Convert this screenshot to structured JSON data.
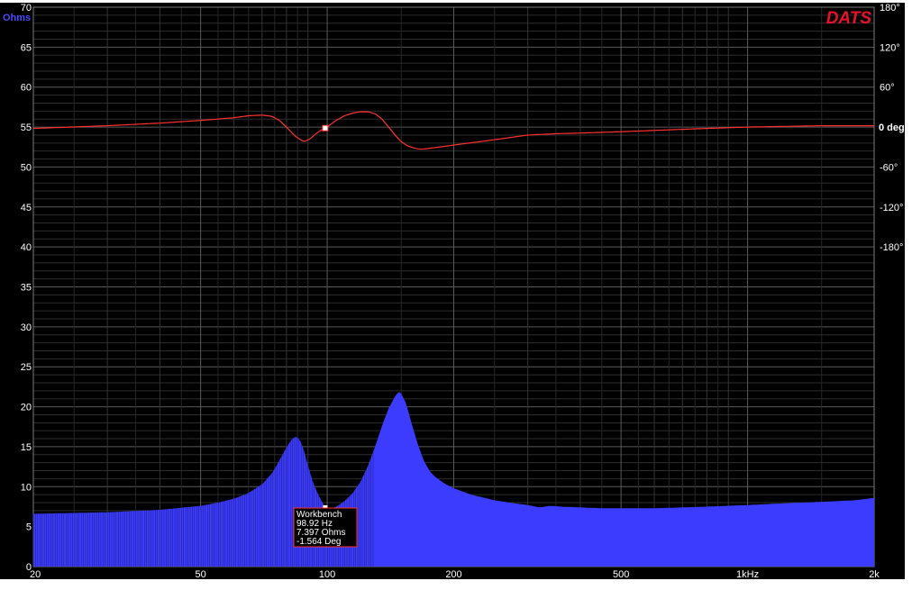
{
  "chart_data": {
    "type": "area",
    "brand": "DATS",
    "x_axis": {
      "scale": "log",
      "range_hz": [
        20,
        2000
      ],
      "tick_values": [
        20,
        50,
        100,
        200,
        500,
        1000,
        2000
      ],
      "tick_labels": [
        "20",
        "50",
        "100",
        "200",
        "500",
        "1kHz",
        "2k"
      ]
    },
    "y_left": {
      "label": "Ohms",
      "range": [
        0,
        70
      ],
      "ticks": [
        0,
        5,
        10,
        15,
        20,
        25,
        30,
        35,
        40,
        45,
        50,
        55,
        60,
        65,
        70
      ],
      "color": "#4a4aff"
    },
    "y_right": {
      "range_deg": [
        -180,
        180
      ],
      "ticks": [
        180,
        120,
        60,
        0,
        -60,
        -120,
        -180
      ],
      "tick_labels": [
        "180°",
        "120°",
        "60°",
        "0 deg",
        "-60°",
        "-120°",
        "-180°"
      ],
      "zero_color": "#e03030"
    },
    "grid": true,
    "series": [
      {
        "kind": "impedance",
        "color": "#3c3cff",
        "x": [
          20,
          30,
          40,
          50,
          55,
          60,
          65,
          70,
          74,
          77,
          80,
          82,
          84,
          86,
          88,
          90,
          93,
          96,
          99,
          102,
          106,
          110,
          115,
          120,
          125,
          130,
          135,
          140,
          145,
          148,
          150,
          153,
          156,
          160,
          165,
          170,
          175,
          180,
          190,
          200,
          220,
          250,
          280,
          300,
          320,
          340,
          360,
          400,
          450,
          500,
          600,
          700,
          800,
          1000,
          1200,
          1500,
          1800,
          2000
        ],
        "y": [
          6.6,
          6.8,
          7.1,
          7.6,
          8.0,
          8.5,
          9.2,
          10.3,
          11.7,
          13.3,
          14.9,
          15.8,
          16.3,
          15.9,
          14.6,
          12.6,
          10.2,
          8.6,
          7.4,
          7.2,
          7.6,
          8.2,
          9.2,
          10.6,
          12.6,
          15.0,
          17.6,
          19.8,
          21.3,
          21.9,
          21.6,
          20.8,
          19.4,
          17.3,
          15.0,
          13.2,
          12.0,
          11.3,
          10.4,
          9.8,
          9.0,
          8.3,
          7.9,
          7.7,
          7.4,
          7.6,
          7.5,
          7.4,
          7.3,
          7.3,
          7.3,
          7.4,
          7.5,
          7.7,
          7.9,
          8.1,
          8.3,
          8.6
        ]
      },
      {
        "kind": "phase",
        "color": "#ff3030",
        "x": [
          20,
          30,
          40,
          50,
          60,
          65,
          70,
          74,
          77,
          80,
          84,
          88,
          91,
          94,
          97,
          100,
          105,
          110,
          115,
          120,
          125,
          130,
          135,
          140,
          145,
          150,
          155,
          160,
          165,
          170,
          175,
          180,
          190,
          200,
          250,
          300,
          350,
          400,
          500,
          600,
          800,
          1000,
          1500,
          2000
        ],
        "y": [
          -2,
          2,
          6,
          10,
          14,
          17,
          18,
          16,
          10,
          0,
          -14,
          -22,
          -18,
          -10,
          -4,
          0,
          10,
          17,
          21,
          23,
          23,
          20,
          12,
          0,
          -12,
          -22,
          -28,
          -31,
          -33,
          -33,
          -32,
          -31,
          -29,
          -27,
          -19,
          -12,
          -10,
          -9,
          -7,
          -5,
          -2,
          0,
          2,
          2
        ]
      }
    ],
    "annotation": {
      "lines": [
        "Workbench",
        "98.92 Hz",
        "7.397 Ohms",
        "-1.564 Deg"
      ],
      "frequency_hz": 98.92,
      "ohms": 7.397,
      "deg": -1.564
    }
  }
}
